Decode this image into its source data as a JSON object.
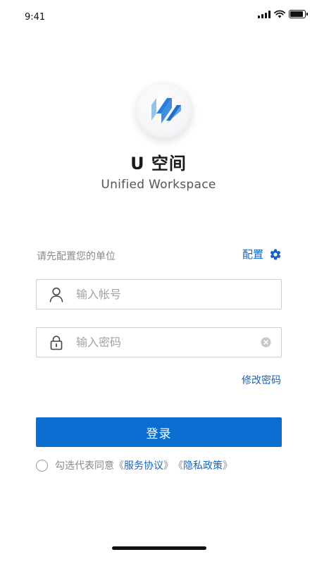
{
  "status_bar": {
    "time": "9:41",
    "battery_level": 0.9
  },
  "app": {
    "title": "U 空间",
    "subtitle": "Unified  Workspace"
  },
  "config": {
    "hint": "请先配置您的单位",
    "label": "配置"
  },
  "account": {
    "placeholder": "输入帐号",
    "value": ""
  },
  "password": {
    "placeholder": "输入密码",
    "value": ""
  },
  "change_password": "修改密码",
  "login_label": "登录",
  "agreement": {
    "prefix": "勾选代表同意",
    "open1": "《",
    "service": "服务协议",
    "close1": "》",
    "open2": "《",
    "privacy": "隐私政策",
    "close2": "》"
  },
  "colors": {
    "accent": "#0a6ed1",
    "link": "#1565c0"
  }
}
